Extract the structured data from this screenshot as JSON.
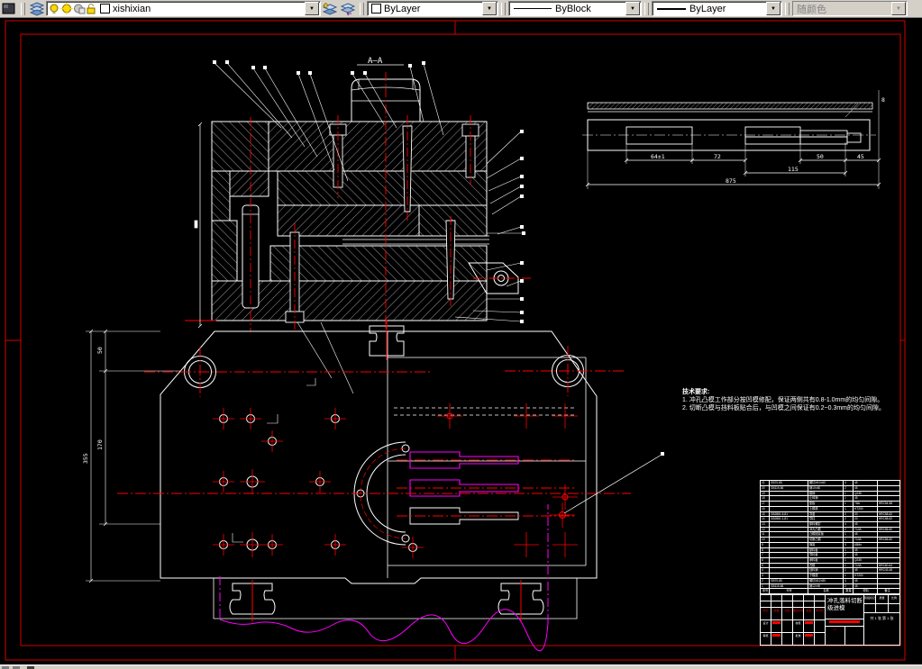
{
  "toolbar": {
    "layer_name": "xishixian",
    "color_value": "ByLayer",
    "linetype_value": "ByBlock",
    "lineweight_value": "ByLayer",
    "plotstyle_value": "随颜色"
  },
  "drawing": {
    "section_label": "A—A",
    "tech_notes": {
      "title": "技术要求:",
      "line1": "1. 冲孔凸模工作部分按凹模修配，保证两侧共有0.8-1.0mm的均匀间隙。",
      "line2": "2. 切断凸模与挡料板贴合后，与凹模之间保证有0.2~0.3mm的均匀间隙。"
    },
    "dims": {
      "strip_64": "64±1",
      "strip_72": "72",
      "strip_115": "115",
      "strip_50": "50",
      "strip_45": "45",
      "strip_875": "875",
      "strip_8": "8",
      "plan_50": "50",
      "plan_170": "170",
      "plan_355": "355"
    }
  },
  "bom": {
    "header": [
      "序号",
      "代号",
      "名称",
      "数量",
      "材料",
      "备注"
    ],
    "rows": [
      [
        "1",
        "GB119-86",
        "销12×90",
        "2",
        "45",
        ""
      ],
      [
        "2",
        "GB70-85",
        "螺钉M12×80",
        "4",
        "45",
        ""
      ],
      [
        "3",
        "",
        "下模座",
        "1",
        "HT200",
        ""
      ],
      [
        "4",
        "",
        "挡料销",
        "1",
        "45",
        "HRC43-48"
      ],
      [
        "5",
        "",
        "凹模",
        "1",
        "T10A",
        "HRC60-64"
      ],
      [
        "6",
        "",
        "承料板",
        "1",
        "Q235",
        ""
      ],
      [
        "7",
        "",
        "导料板",
        "2",
        "45",
        ""
      ],
      [
        "8",
        "",
        "卸料板",
        "1",
        "45",
        ""
      ],
      [
        "9",
        "",
        "弹簧",
        "4",
        "65Mn",
        ""
      ],
      [
        "10",
        "",
        "切断凸模",
        "1",
        "T10A",
        "HRC56-60"
      ],
      [
        "11",
        "",
        "凸模固定板",
        "1",
        "45",
        ""
      ],
      [
        "12",
        "",
        "冲孔凸模",
        "2",
        "T10A",
        "HRC56-60"
      ],
      [
        "13",
        "",
        "卸料螺钉",
        "4",
        "45",
        ""
      ],
      [
        "14",
        "GB2861.1-81",
        "导柱",
        "2",
        "20",
        "HRC58-62"
      ],
      [
        "15",
        "GB2861.6-81",
        "导套",
        "2",
        "20",
        "HRC58-62"
      ],
      [
        "16",
        "",
        "上模座",
        "1",
        "HT200",
        ""
      ],
      [
        "17",
        "",
        "垫板",
        "1",
        "T8A",
        "HRC54-58"
      ],
      [
        "18",
        "",
        "止转销",
        "1",
        "45",
        ""
      ],
      [
        "19",
        "",
        "模柄",
        "1",
        "Q235",
        ""
      ],
      [
        "20",
        "GB119-86",
        "销10×80",
        "2",
        "45",
        ""
      ],
      [
        "21",
        "GB70-85",
        "螺钉M10×60",
        "4",
        "45",
        ""
      ]
    ]
  },
  "titleblock": {
    "title": "冲孔落料切断级进模",
    "rev_row": [
      "标记",
      "处数",
      "分区",
      "更改文件号",
      "签名",
      "年月日"
    ],
    "sign_labels": [
      "设计",
      "校核",
      "审核",
      "批准"
    ],
    "stage_label": "阶段标记",
    "weight_label": "质量",
    "scale_label": "比例",
    "scale_value": "1:1",
    "sheets": "共 1 张 第 1 张"
  }
}
